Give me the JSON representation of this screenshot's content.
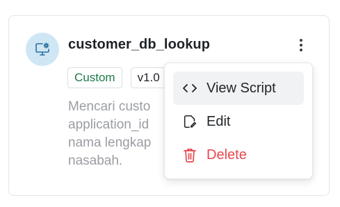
{
  "card": {
    "title": "customer_db_lookup",
    "avatar_icon": "monitor-gear-icon",
    "badges": [
      {
        "label": "Custom",
        "color": "#1b7a4a"
      },
      {
        "label": "v1.0",
        "color": "#1f2328"
      }
    ],
    "description_lines": [
      "Mencari custo",
      "application_id",
      "nama lengkap",
      "nasabah."
    ],
    "more_icon": "kebab-vertical-icon"
  },
  "menu": {
    "items": [
      {
        "label": "View Script",
        "icon": "code-icon",
        "active": true
      },
      {
        "label": "Edit",
        "icon": "edit-icon",
        "active": false
      },
      {
        "label": "Delete",
        "icon": "trash-icon",
        "active": false,
        "color": "#e5484d"
      }
    ]
  },
  "colors": {
    "accent_avatar_bg": "#cfe6f5",
    "icon_blue": "#2b6f9e",
    "danger": "#e5484d",
    "muted_text": "#9a9da3"
  }
}
